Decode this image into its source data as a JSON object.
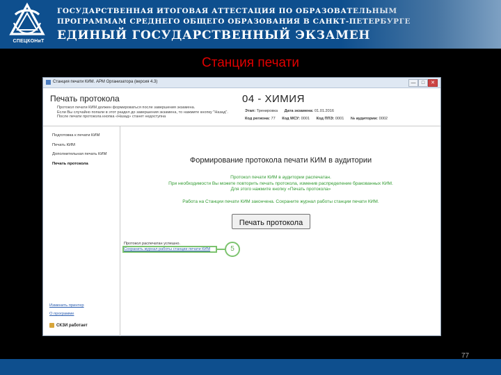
{
  "banner": {
    "logo_text": "СПЕЦКОНиТ",
    "line1": "ГОСУДАРСТВЕННАЯ ИТОГОВАЯ АТТЕСТАЦИЯ ПО ОБРАЗОВАТЕЛЬНЫМ",
    "line2": "ПРОГРАММАМ СРЕДНЕГО ОБЩЕГО ОБРАЗОВАНИЯ В САНКТ-ПЕТЕРБУРГЕ",
    "line3": "ЕДИНЫЙ ГОСУДАРСТВЕННЫЙ ЭКЗАМЕН"
  },
  "slide": {
    "title": "Станция печати",
    "page_number": "77"
  },
  "window": {
    "title": "Станция печати КИМ. АРМ Организатора (версия 4.3)",
    "btn_min": "—",
    "btn_max": "□",
    "btn_close": "✕"
  },
  "header": {
    "heading": "Печать протокола",
    "notice": [
      "Протокол печати КИМ должен формироваться после завершения экзамена.",
      "Если Вы случайно попали в этот раздел до завершения экзамена, то нажмите кнопку \"Назад\".",
      "После печати протокола кнопка «Назад» станет недоступна"
    ],
    "exam_title": "04 - ХИМИЯ",
    "stage_label": "Этап:",
    "stage_value": "Тренировка",
    "date_label": "Дата экзамена:",
    "date_value": "01.01.2016",
    "region_label": "Код региона:",
    "region_value": "77",
    "msu_label": "Код МСУ:",
    "msu_value": "0001",
    "ppe_label": "Код ППЭ:",
    "ppe_value": "0001",
    "aud_label": "№ аудитории:",
    "aud_value": "0002"
  },
  "sidebar": {
    "items": [
      {
        "label": "Подготовка к печати КИМ"
      },
      {
        "label": "Печать КИМ"
      },
      {
        "label": "Дополнительная печать КИМ"
      },
      {
        "label": "Печать протокола"
      }
    ],
    "change_printer": "Изменить принтер",
    "about": "О программе",
    "crypto_status": "СКЗИ работает"
  },
  "main": {
    "title": "Формирование протокола печати КИМ в аудитории",
    "msg1": "Протокол печати КИМ в аудитории распечатан.",
    "msg2": "При необходимости Вы можете повторить печать протокола, изменив распределение бракованных КИМ.",
    "msg3": "Для этого нажмите кнопку «Печать протокола»",
    "msg4": "Работа на Станции печати КИМ закончена. Сохраните журнал работы станции печати КИМ.",
    "print_button": "Печать протокола",
    "status_printed": "Протокол распечатан успешно.",
    "save_log_link": "Сохранить журнал работы станции печати КИМ",
    "step_number": "5"
  },
  "colors": {
    "banner": "#0e4f8e",
    "title_red": "#e00000",
    "message_green": "#2f9a2f",
    "highlight_green": "#7cc36e"
  }
}
